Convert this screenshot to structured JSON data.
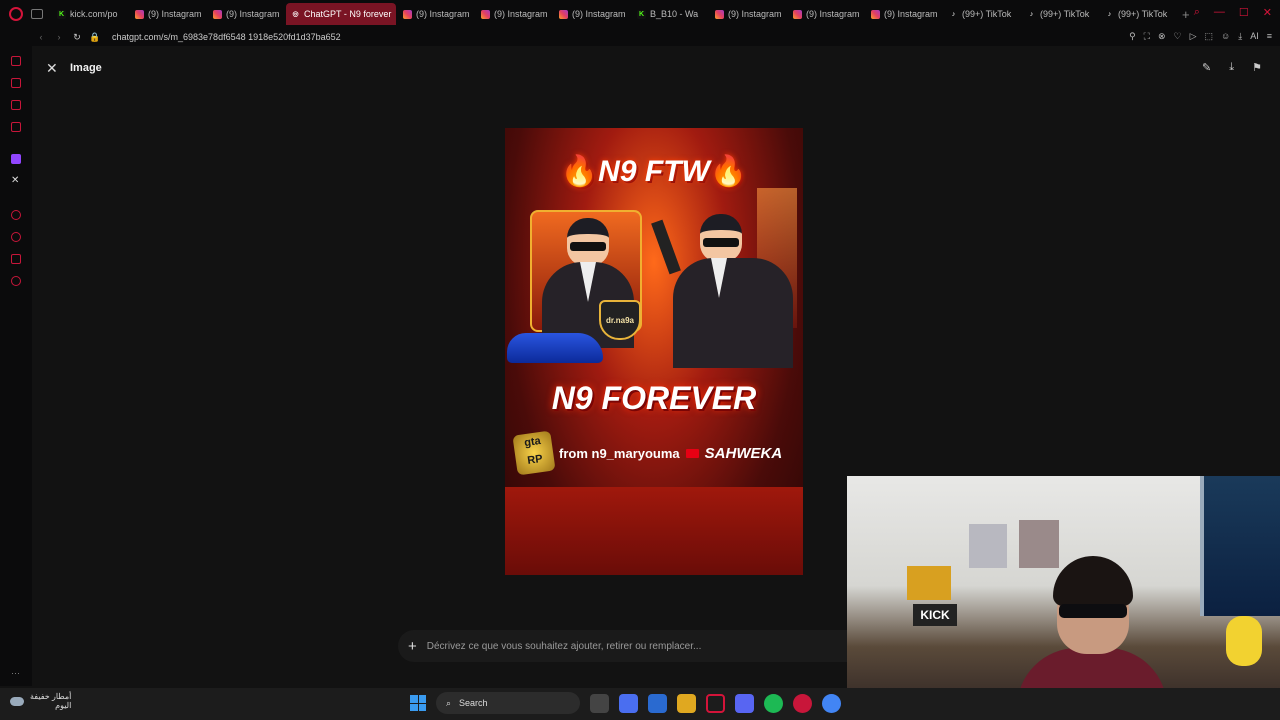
{
  "tabs": [
    {
      "label": "kick.com/po",
      "favicon": "kick",
      "active": false
    },
    {
      "label": "(9) Instagram",
      "favicon": "instagram",
      "active": false
    },
    {
      "label": "(9) Instagram",
      "favicon": "instagram",
      "active": false
    },
    {
      "label": "ChatGPT - N9 forever",
      "favicon": "chatgpt",
      "active": true
    },
    {
      "label": "(9) Instagram",
      "favicon": "instagram",
      "active": false
    },
    {
      "label": "(9) Instagram",
      "favicon": "instagram",
      "active": false
    },
    {
      "label": "(9) Instagram",
      "favicon": "instagram",
      "active": false
    },
    {
      "label": "B_B10 - Wa",
      "favicon": "kick",
      "active": false
    },
    {
      "label": "(9) Instagram",
      "favicon": "instagram",
      "active": false
    },
    {
      "label": "(9) Instagram",
      "favicon": "instagram",
      "active": false
    },
    {
      "label": "(9) Instagram",
      "favicon": "instagram",
      "active": false
    },
    {
      "label": "(99+) TikTok",
      "favicon": "tiktok",
      "active": false
    },
    {
      "label": "(99+) TikTok",
      "favicon": "tiktok",
      "active": false
    },
    {
      "label": "(99+) TikTok",
      "favicon": "tiktok",
      "active": false
    }
  ],
  "address": {
    "url": "chatgpt.com/s/m_6983e78df6548 1918e520fd1d37ba652"
  },
  "addr_right": {
    "ai_label": "AI"
  },
  "viewer": {
    "title": "Image"
  },
  "poster": {
    "heading": "N9 FTW",
    "badge": "dr.na9a",
    "main": "N9 FOREVER",
    "gta_top": "gta",
    "gta_bottom": "RP",
    "from_line": "from n9_maryouma",
    "brand": "SAHWEKA"
  },
  "prompt": {
    "placeholder": "Décrivez ce que vous souhaitez ajouter, retirer ou remplacer..."
  },
  "webcam": {
    "sign": "KICK"
  },
  "taskbar": {
    "weather_line1": "أمطار خفيفة",
    "weather_line2": "اليوم",
    "search_label": "Search"
  },
  "colors": {
    "accent": "#d4143a",
    "active_tab": "#7a1424"
  }
}
